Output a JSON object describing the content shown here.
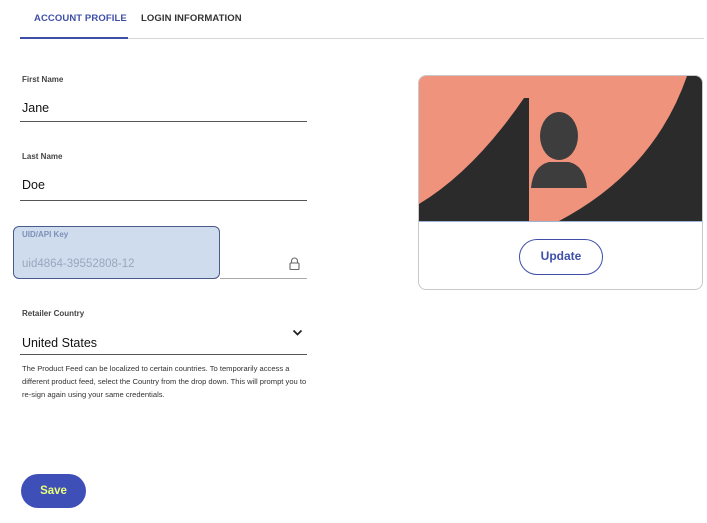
{
  "tabs": [
    {
      "label": "ACCOUNT PROFILE",
      "active": true
    },
    {
      "label": "LOGIN INFORMATION",
      "active": false
    }
  ],
  "form": {
    "first_name": {
      "label": "First Name",
      "value": "Jane"
    },
    "last_name": {
      "label": "Last Name",
      "value": "Doe"
    },
    "uid": {
      "label": "UID/API Key",
      "value": "uid4864-39552808-12",
      "icon": "lock-icon"
    },
    "country": {
      "label": "Retailer Country",
      "value": "United States",
      "icon": "chevron-down-icon"
    },
    "help_text": "The Product Feed can be localized to certain countries. To temporarily access a different product feed, select the Country from the drop down. This will prompt you to re-sign again using your same credentials."
  },
  "buttons": {
    "save": "Save",
    "update": "Update"
  },
  "colors": {
    "accent": "#3f4fa8",
    "save_bg": "#3f4fb8",
    "save_text": "#e8ff7a",
    "card_salmon": "#f0937c",
    "card_dark": "#2b2b2b",
    "uid_highlight": "#cfdcee"
  }
}
